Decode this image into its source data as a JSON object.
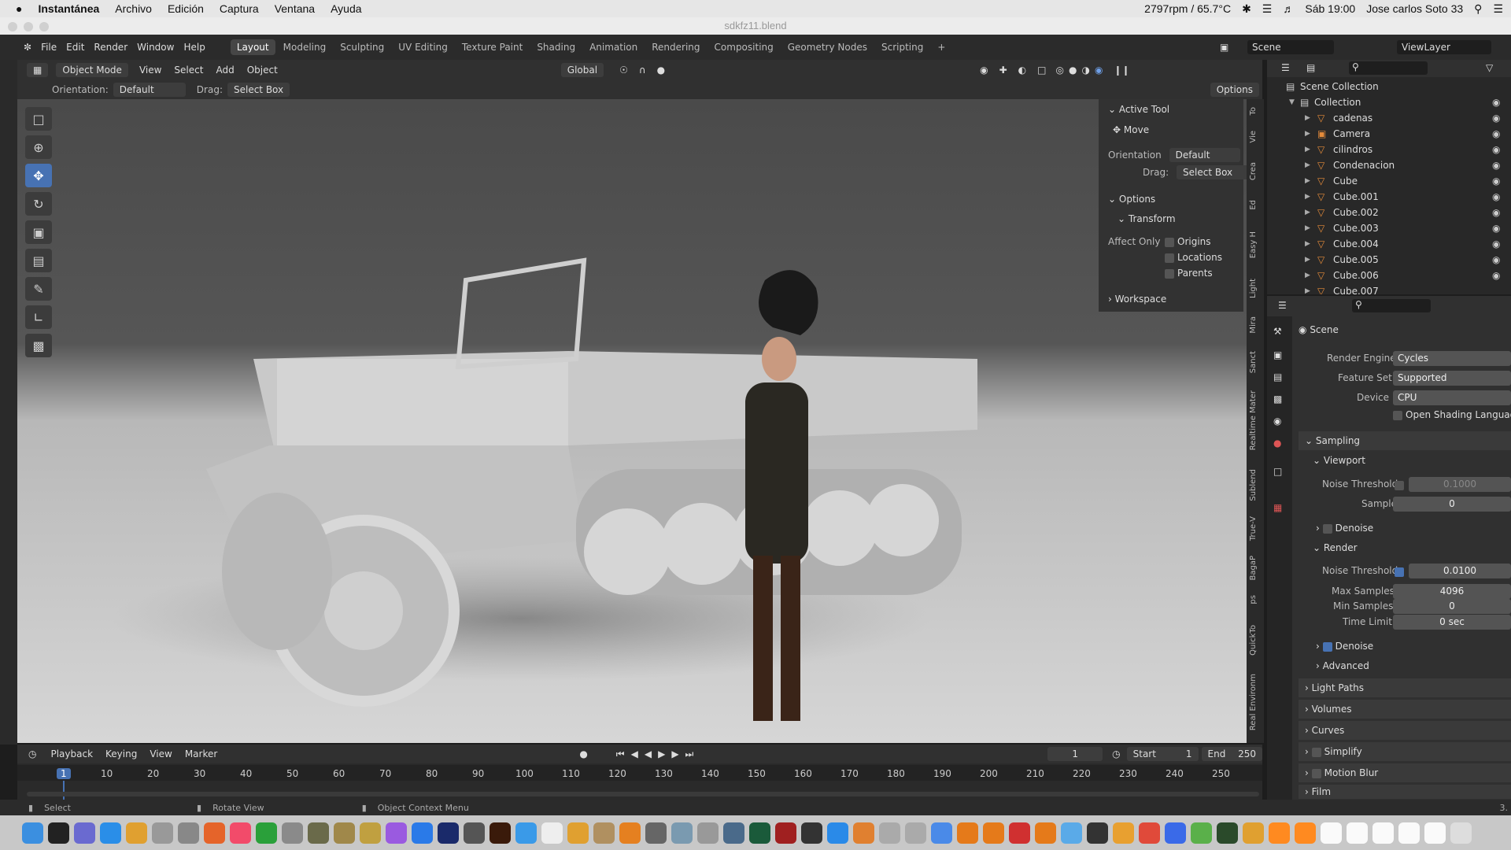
{
  "menubar": {
    "apple": "",
    "app": "Instantánea",
    "items": [
      "Archivo",
      "Edición",
      "Captura",
      "Ventana",
      "Ayuda"
    ],
    "fan": "2797rpm / 65.7°C",
    "time": "Sáb 19:00",
    "user": "Jose carlos Soto 33"
  },
  "window": {
    "title": "sdkfz11.blend"
  },
  "blender_menu": [
    "File",
    "Edit",
    "Render",
    "Window",
    "Help"
  ],
  "workspaces": [
    "Layout",
    "Modeling",
    "Sculpting",
    "UV Editing",
    "Texture Paint",
    "Shading",
    "Animation",
    "Rendering",
    "Compositing",
    "Geometry Nodes",
    "Scripting",
    "+"
  ],
  "scene": "Scene",
  "viewlayer": "ViewLayer",
  "header": {
    "mode": "Object Mode",
    "menus": [
      "View",
      "Select",
      "Add",
      "Object"
    ],
    "transform": "Global"
  },
  "subheader": {
    "orientation_label": "Orientation:",
    "orientation": "Default",
    "drag_label": "Drag:",
    "drag": "Select Box",
    "options": "Options"
  },
  "npanel": {
    "active_tool": "Active Tool",
    "move": "Move",
    "orientation_label": "Orientation",
    "orientation": "Default",
    "drag_label": "Drag:",
    "drag": "Select Box",
    "options": "Options",
    "transform": "Transform",
    "affect_only": "Affect Only",
    "origins": "Origins",
    "locations": "Locations",
    "parents": "Parents",
    "workspace": "Workspace"
  },
  "side_tabs": [
    "Real Environm",
    "QuickTo",
    "ps",
    "BagaP",
    "True-V",
    "Sublend",
    "Realtime Mater",
    "Sanct",
    "Mira",
    "Light",
    "Easy H",
    "Ed",
    "Crea",
    "Vie",
    "To"
  ],
  "outliner": {
    "root": "Scene Collection",
    "collection": "Collection",
    "items": [
      "cadenas",
      "Camera",
      "cilindros",
      "Condenacion",
      "Cube",
      "Cube.001",
      "Cube.002",
      "Cube.003",
      "Cube.004",
      "Cube.005",
      "Cube.006",
      "Cube.007"
    ]
  },
  "properties": {
    "scene": "Scene",
    "render_engine_label": "Render Engine",
    "render_engine": "Cycles",
    "feature_set_label": "Feature Set",
    "feature_set": "Supported",
    "device_label": "Device",
    "device": "CPU",
    "osl": "Open Shading Language",
    "sampling": "Sampling",
    "viewport": "Viewport",
    "noise_threshold": "Noise Threshold",
    "vp_noise": "0.1000",
    "samples": "Samples",
    "vp_samples": "0",
    "denoise": "Denoise",
    "render": "Render",
    "r_noise": "0.0100",
    "max_samples": "Max Samples",
    "max_samples_v": "4096",
    "min_samples": "Min Samples",
    "min_samples_v": "0",
    "time_limit": "Time Limit",
    "time_limit_v": "0 sec",
    "advanced": "Advanced",
    "light_paths": "Light Paths",
    "volumes": "Volumes",
    "curves": "Curves",
    "simplify": "Simplify",
    "motion_blur": "Motion Blur",
    "film": "Film"
  },
  "timeline": {
    "menus": [
      "Playback",
      "Keying",
      "View",
      "Marker"
    ],
    "frame": "1",
    "start_label": "Start",
    "start": "1",
    "end_label": "End",
    "end": "250",
    "ticks": [
      "1",
      "10",
      "20",
      "30",
      "40",
      "50",
      "60",
      "70",
      "80",
      "90",
      "100",
      "110",
      "120",
      "130",
      "140",
      "150",
      "160",
      "170",
      "180",
      "190",
      "200",
      "210",
      "220",
      "230",
      "240",
      "250"
    ]
  },
  "status": {
    "select": "Select",
    "rotate": "Rotate View",
    "context": "Object Context Menu",
    "version": "3."
  }
}
